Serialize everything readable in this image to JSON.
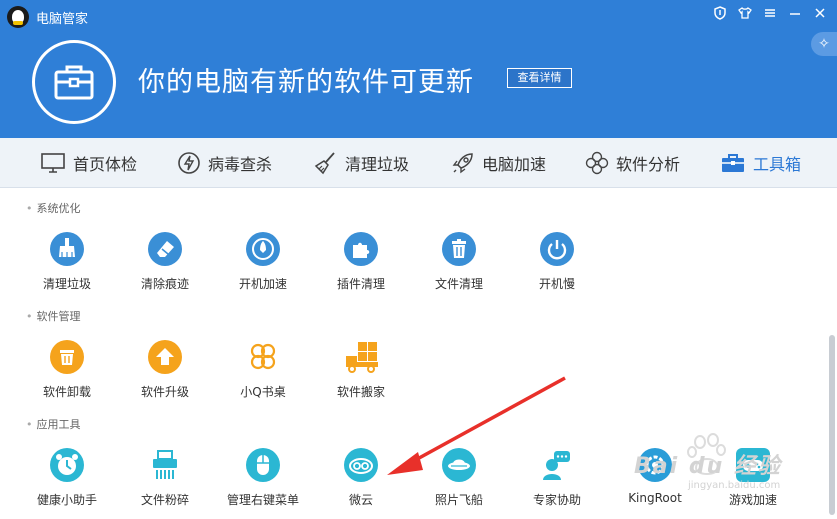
{
  "app": {
    "title": "电脑管家"
  },
  "banner": {
    "message": "你的电脑有新的软件可更新",
    "detail_button": "查看详情"
  },
  "nav": [
    {
      "label": "首页体检",
      "icon": "monitor-icon"
    },
    {
      "label": "病毒查杀",
      "icon": "lightning-icon"
    },
    {
      "label": "清理垃圾",
      "icon": "broom-icon"
    },
    {
      "label": "电脑加速",
      "icon": "rocket-icon"
    },
    {
      "label": "软件分析",
      "icon": "flower-icon"
    },
    {
      "label": "工具箱",
      "icon": "toolbox-icon",
      "active": true
    }
  ],
  "sections": [
    {
      "title": "系统优化",
      "tools": [
        {
          "label": "清理垃圾",
          "icon": "broom-icon"
        },
        {
          "label": "清除痕迹",
          "icon": "eraser-icon"
        },
        {
          "label": "开机加速",
          "icon": "rocket-icon"
        },
        {
          "label": "插件清理",
          "icon": "puzzle-icon"
        },
        {
          "label": "文件清理",
          "icon": "trash-icon"
        },
        {
          "label": "开机慢",
          "icon": "power-icon"
        }
      ]
    },
    {
      "title": "软件管理",
      "tools": [
        {
          "label": "软件卸载",
          "icon": "uninstall-icon"
        },
        {
          "label": "软件升级",
          "icon": "upgrade-icon"
        },
        {
          "label": "小Q书桌",
          "icon": "clover-icon"
        },
        {
          "label": "软件搬家",
          "icon": "truck-icon"
        }
      ]
    },
    {
      "title": "应用工具",
      "tools": [
        {
          "label": "健康小助手",
          "icon": "clock-icon"
        },
        {
          "label": "文件粉碎",
          "icon": "shredder-icon"
        },
        {
          "label": "管理右键菜单",
          "icon": "mouse-icon"
        },
        {
          "label": "微云",
          "icon": "cloud-icon"
        },
        {
          "label": "照片飞船",
          "icon": "ufo-icon"
        },
        {
          "label": "专家协助",
          "icon": "expert-icon"
        },
        {
          "label": "KingRoot",
          "icon": "kingroot-icon"
        },
        {
          "label": "游戏加速",
          "icon": "game-icon"
        }
      ]
    }
  ],
  "watermark": {
    "text": "Bai du 经验",
    "url": "jingyan.baidu.com"
  },
  "colors": {
    "banner": "#2f7fd7",
    "active_nav": "#2b78d5",
    "annotation_arrow": "#e8302a",
    "tool_blue": "#3a8fd6",
    "tool_orange": "#f5a31c"
  }
}
